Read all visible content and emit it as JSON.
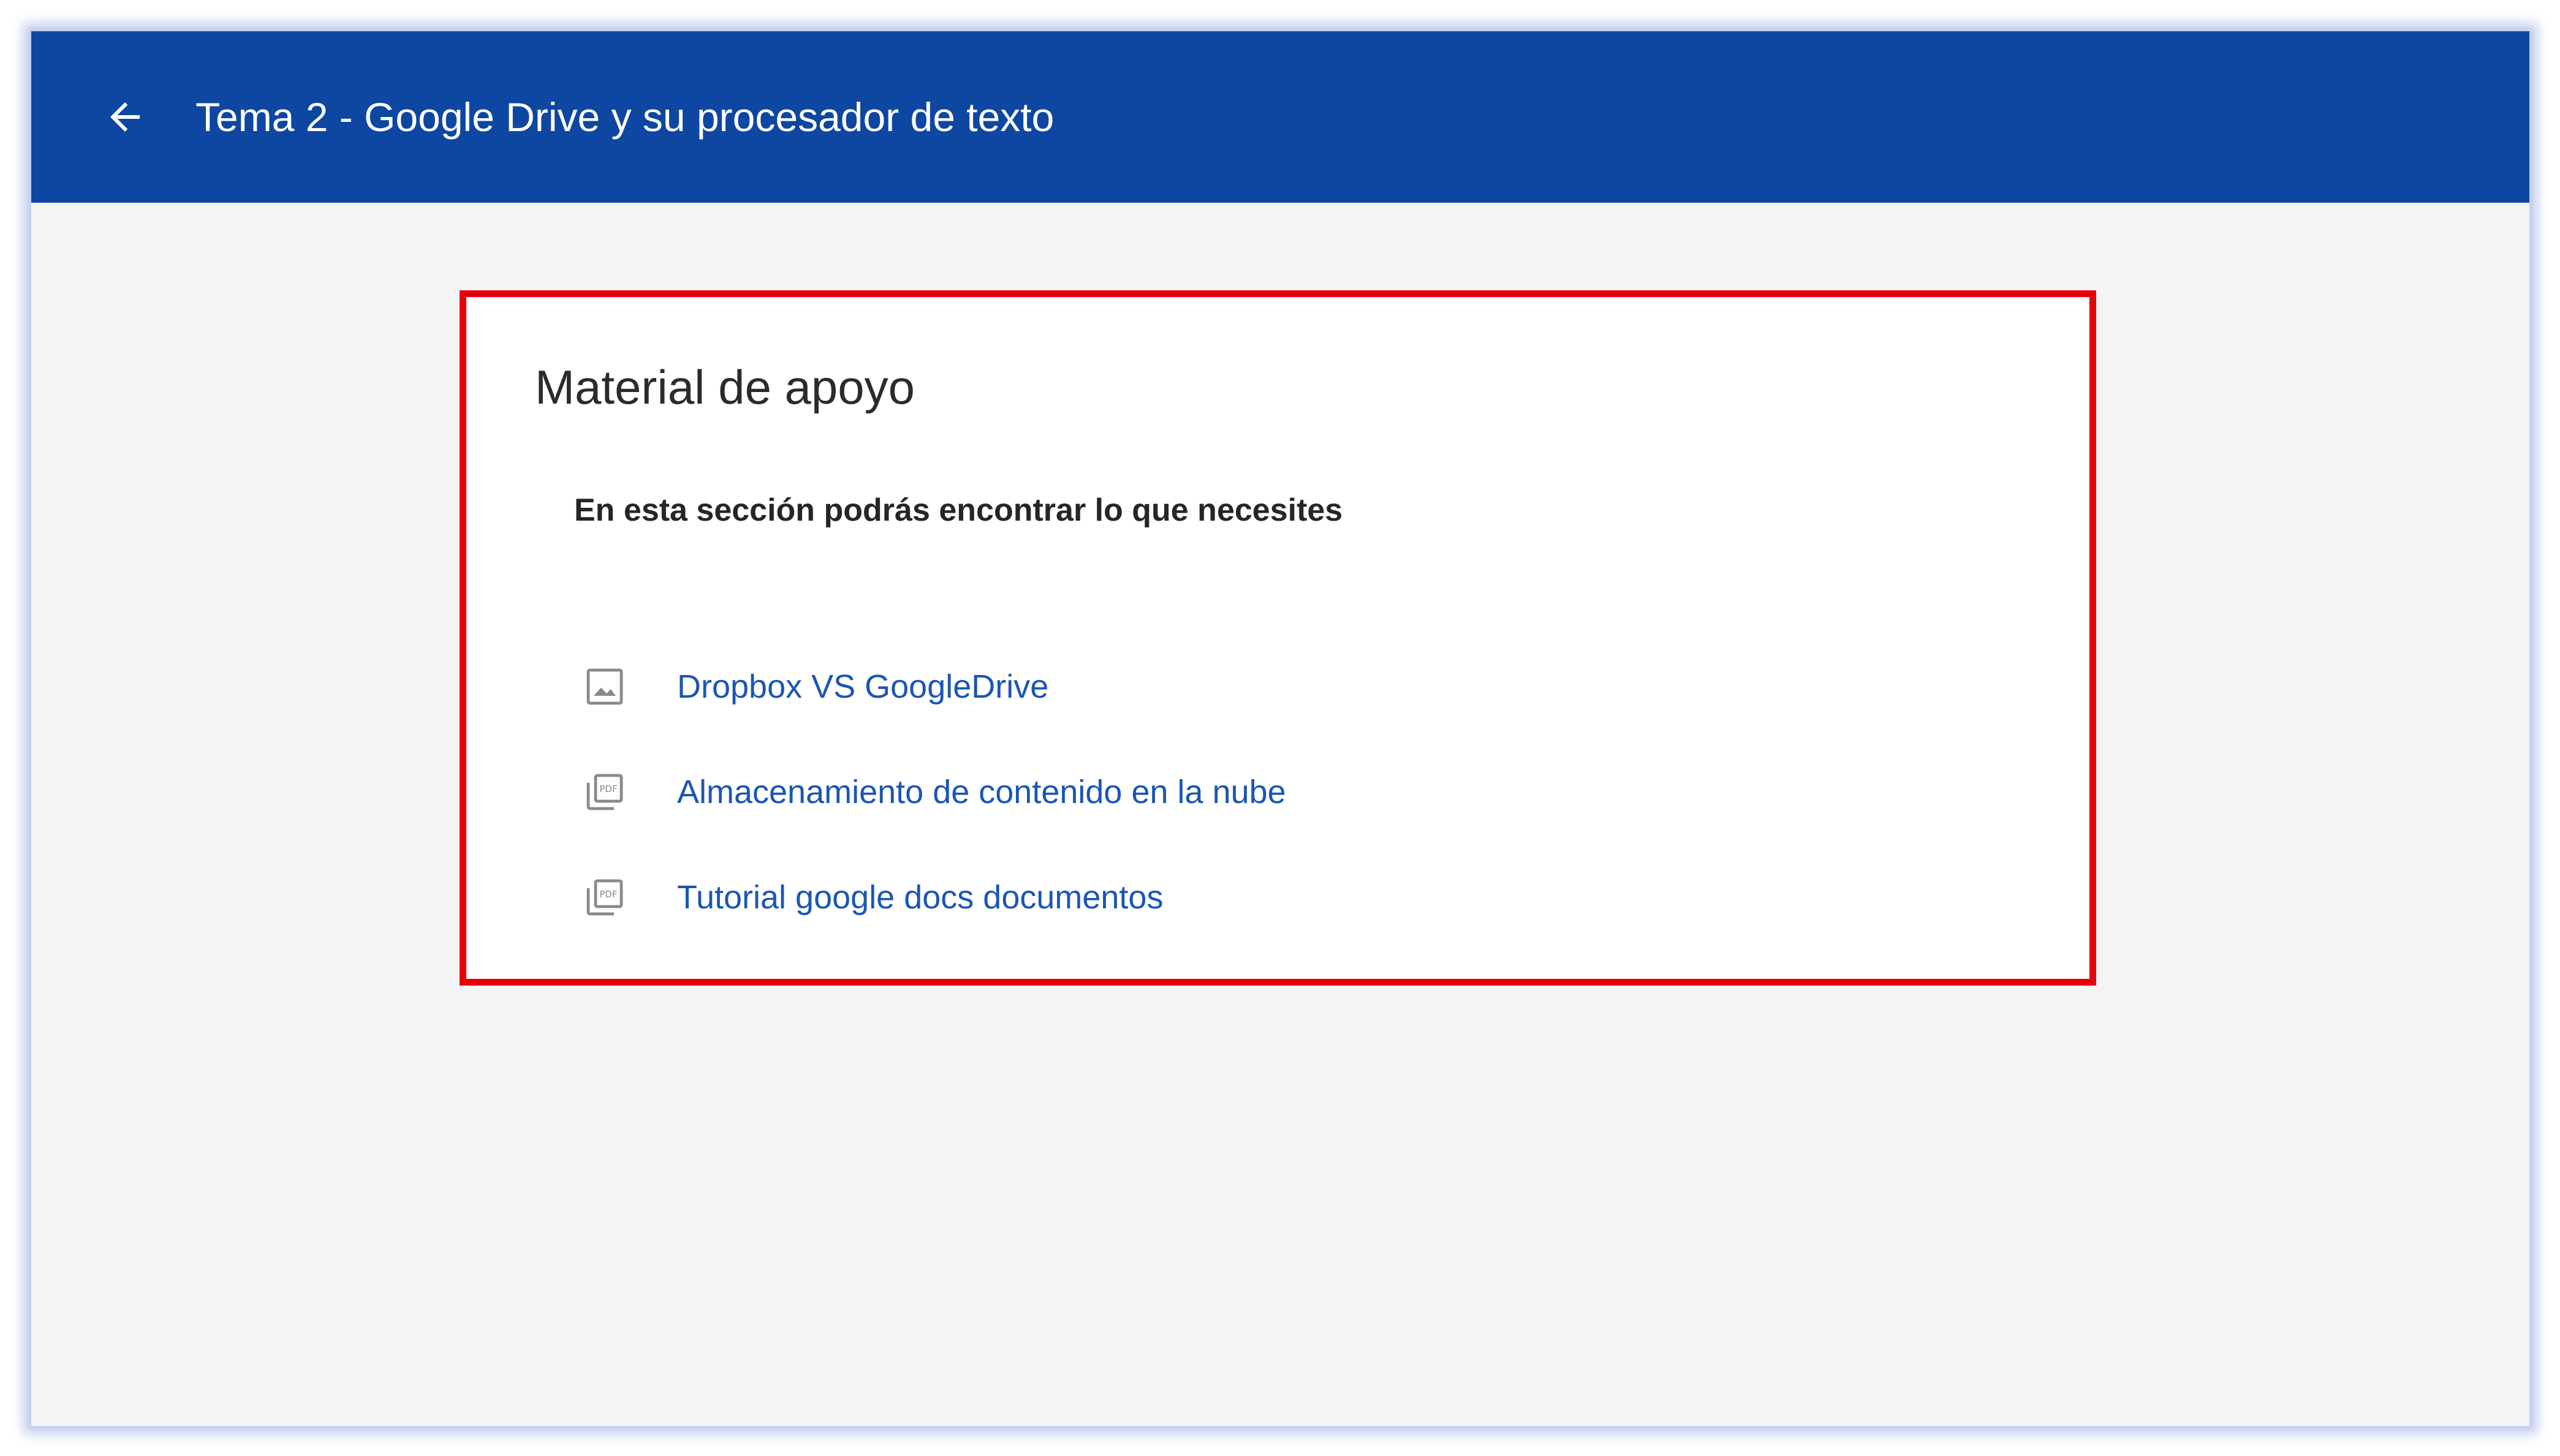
{
  "header": {
    "title": "Tema 2 - Google Drive y su procesador de texto",
    "back_icon": "arrow-left-icon"
  },
  "section": {
    "title": "Material de apoyo",
    "subtitle": "En esta sección podrás encontrar lo que necesites",
    "resources": [
      {
        "label": "Dropbox VS GoogleDrive",
        "icon": "image-icon"
      },
      {
        "label": "Almacenamiento de contenido en la nube",
        "icon": "pdf-icon"
      },
      {
        "label": "Tutorial google docs documentos",
        "icon": "pdf-icon"
      }
    ]
  },
  "colors": {
    "header_bg": "#0e47a1",
    "page_bg": "#f4f4f4",
    "link": "#1a56b4",
    "highlight_border": "#e8000b"
  }
}
